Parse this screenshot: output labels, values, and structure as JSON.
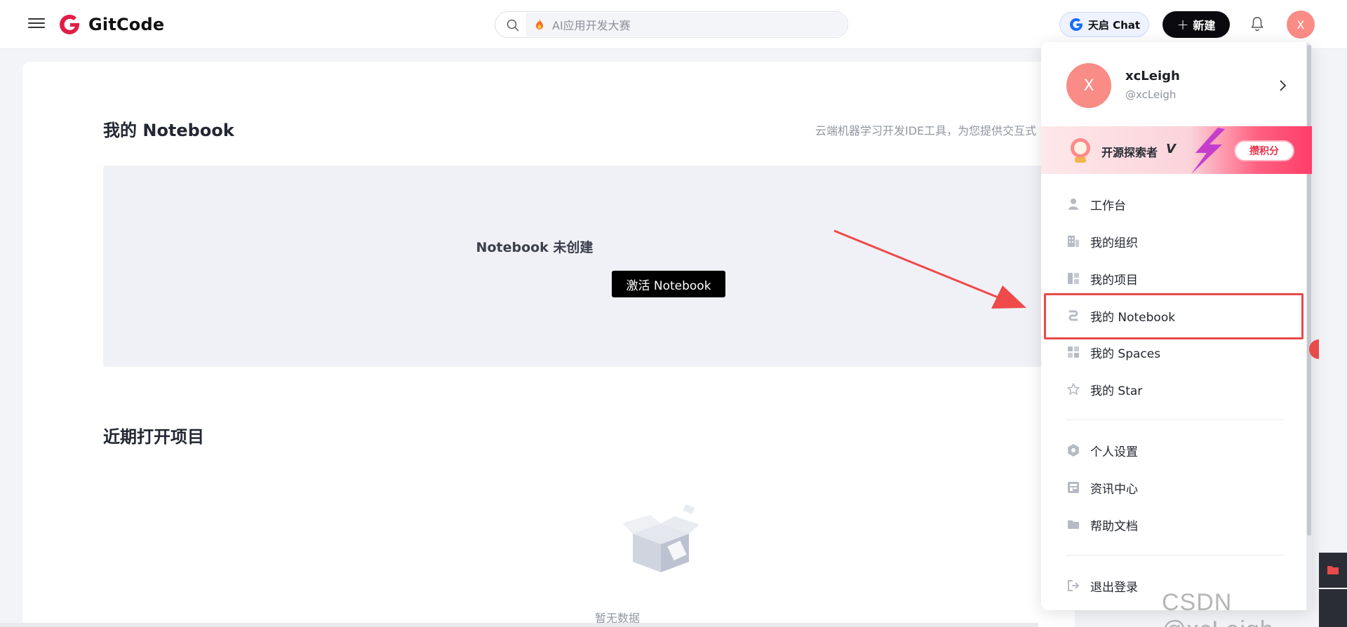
{
  "header": {
    "logo_text": "GitCode",
    "search_placeholder": "AI应用开发大赛",
    "tianqi_label": "天启 Chat",
    "new_label": "新建",
    "avatar_letter": "X"
  },
  "main": {
    "notebook_title": "我的 Notebook",
    "notebook_description": "云端机器学习开发IDE工具，为您提供交互式",
    "notebook_empty": "Notebook 未创建",
    "activate_label": "激活 Notebook",
    "recent_title": "近期打开项目",
    "empty_text": "暂无数据"
  },
  "dropdown": {
    "avatar_letter": "X",
    "name": "xcLeigh",
    "handle": "@xcLeigh",
    "banner_text": "开源探索者",
    "banner_level": "V",
    "banner_button": "攒积分",
    "items": [
      {
        "label": "工作台",
        "icon": "person-icon"
      },
      {
        "label": "我的组织",
        "icon": "organization-icon"
      },
      {
        "label": "我的项目",
        "icon": "project-icon"
      },
      {
        "label": "我的 Notebook",
        "icon": "notebook-icon"
      },
      {
        "label": "我的 Spaces",
        "icon": "spaces-icon"
      },
      {
        "label": "我的 Star",
        "icon": "star-icon"
      },
      {
        "label": "个人设置",
        "icon": "gear-icon"
      },
      {
        "label": "资讯中心",
        "icon": "news-icon"
      },
      {
        "label": "帮助文档",
        "icon": "folder-icon"
      },
      {
        "label": "退出登录",
        "icon": "logout-icon"
      }
    ]
  },
  "watermark": "CSDN @xcLeigh",
  "colors": {
    "brand_red": "#e11d48",
    "avatar": "#f98c86",
    "highlight": "#e94a4a",
    "accent_black": "#0b0b0f"
  }
}
